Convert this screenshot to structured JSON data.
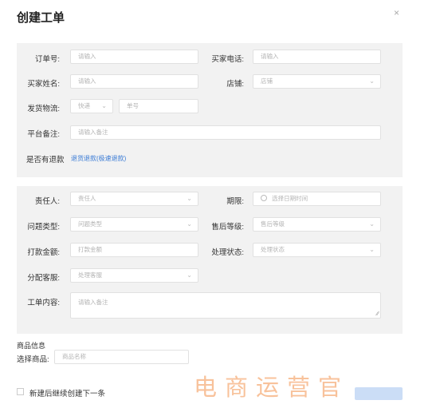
{
  "dialog": {
    "title": "创建工单",
    "close_icon": "×"
  },
  "basic": {
    "order_no": {
      "label": "订单号:",
      "placeholder": "请输入"
    },
    "buyer_phone": {
      "label": "买家电话:",
      "placeholder": "请输入"
    },
    "buyer_name": {
      "label": "买家姓名:",
      "placeholder": "请输入"
    },
    "shop": {
      "label": "店铺:",
      "placeholder": "店铺"
    },
    "shipping": {
      "label": "发货物流:",
      "carrier": "快递",
      "tracking_placeholder": "单号"
    },
    "platform_note": {
      "label": "平台备注:",
      "placeholder": "请输入备注"
    },
    "refund": {
      "label": "是否有退款",
      "link": "退货退款(极速退款)"
    }
  },
  "ticket": {
    "assignee": {
      "label": "责任人:",
      "placeholder": "责任人"
    },
    "deadline": {
      "label": "期限:",
      "placeholder": "选择日期时间",
      "icon": "clock-icon"
    },
    "issue_type": {
      "label": "问题类型:",
      "placeholder": "问题类型"
    },
    "after_sale_level": {
      "label": "售后等级:",
      "placeholder": "售后等级"
    },
    "payment_amount": {
      "label": "打款金额:",
      "placeholder": "打款金额"
    },
    "process_status": {
      "label": "处理状态:",
      "placeholder": "处理状态"
    },
    "assign_cs": {
      "label": "分配客服:",
      "placeholder": "处理客服"
    },
    "content": {
      "label": "工单内容:",
      "placeholder": "请输入备注"
    }
  },
  "product": {
    "section_title": "商品信息",
    "select_label": "选择商品:",
    "select_placeholder": "商品名称"
  },
  "footer": {
    "continue_label": "新建后继续创建下一条"
  },
  "watermark": {
    "text": "电商运营官"
  },
  "colors": {
    "accent": "#3a7bd5",
    "panel_bg": "#f2f2f2",
    "watermark": "#f7b88a"
  }
}
